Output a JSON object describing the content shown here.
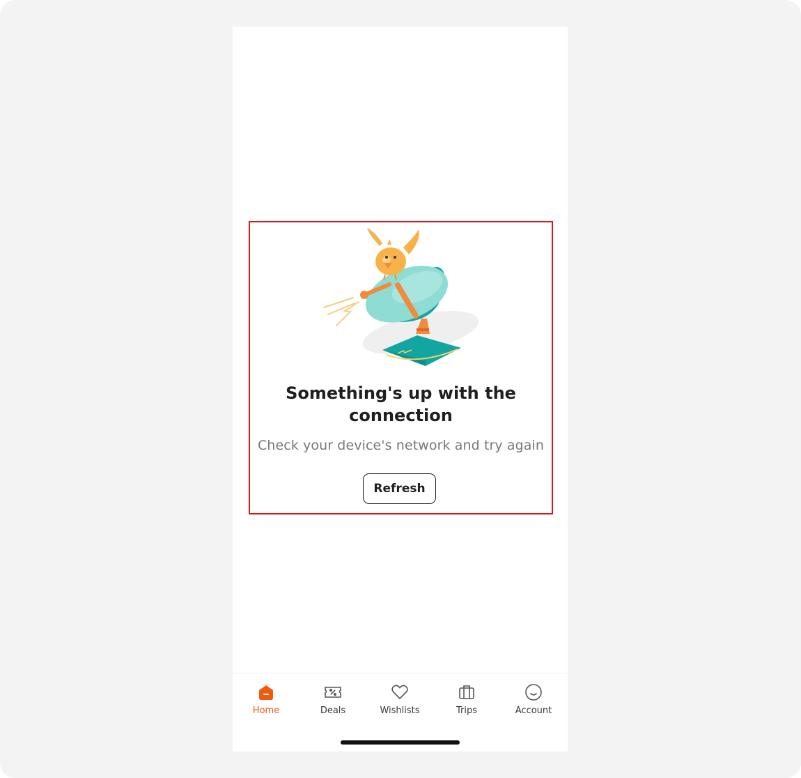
{
  "error": {
    "title": "Something's up with the connection",
    "message": "Check your device's network and try again",
    "refresh_label": "Refresh"
  },
  "nav": {
    "items": [
      {
        "label": "Home",
        "icon": "home-icon",
        "active": true
      },
      {
        "label": "Deals",
        "icon": "deals-icon",
        "active": false
      },
      {
        "label": "Wishlists",
        "icon": "heart-icon",
        "active": false
      },
      {
        "label": "Trips",
        "icon": "suitcase-icon",
        "active": false
      },
      {
        "label": "Account",
        "icon": "account-icon",
        "active": false
      }
    ]
  },
  "colors": {
    "accent": "#ee5b0e",
    "highlight_border": "#d9161b",
    "dish_light": "#7fd8d0",
    "dish_dark": "#13a5a0",
    "bird": "#f9b24a"
  }
}
